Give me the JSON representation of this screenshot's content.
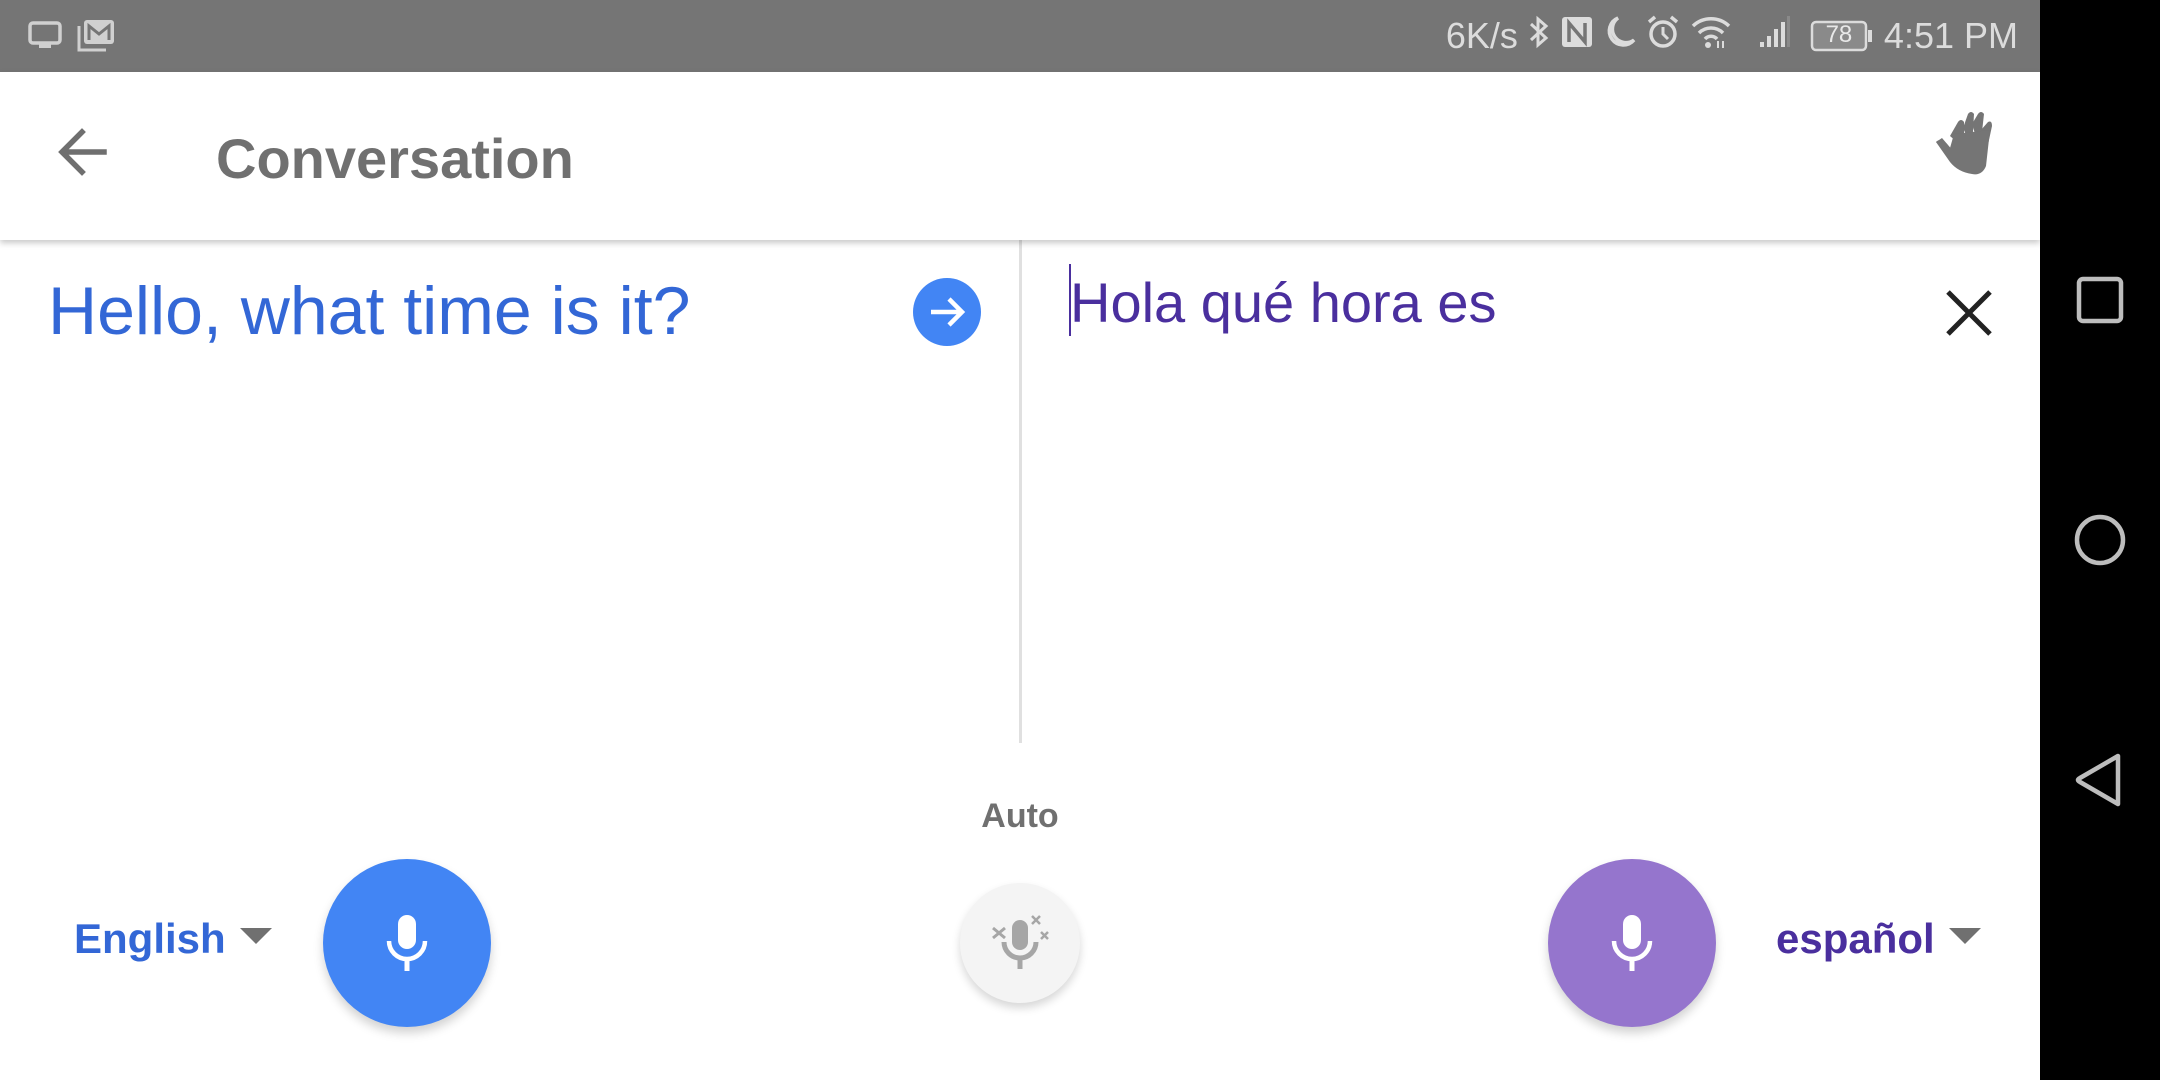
{
  "status_bar": {
    "left_icons": [
      "screen-cast-icon",
      "gmail-icon"
    ],
    "net_speed": "6K/s",
    "icons": [
      "bluetooth-icon",
      "nfc-icon",
      "do-not-disturb-moon-icon",
      "alarm-icon",
      "wifi-icon",
      "signal-icon"
    ],
    "battery": "78",
    "time": "4:51 PM"
  },
  "app_bar": {
    "back_icon": "arrow-back-icon",
    "title": "Conversation",
    "hand_icon": "hand-wave-icon"
  },
  "conversation": {
    "source_text": "Hello, what time is it?",
    "source_color": "#3367d6",
    "translated_text": "Hola qué hora es",
    "translated_color": "#4a2f9e"
  },
  "controls": {
    "auto_label": "Auto",
    "source_language": "English",
    "target_language": "español",
    "source_mic_color": "#4285f4",
    "target_mic_color": "#9575cd"
  },
  "nav_bar": {
    "buttons": [
      "recents-square-icon",
      "home-circle-icon",
      "back-triangle-icon"
    ]
  }
}
